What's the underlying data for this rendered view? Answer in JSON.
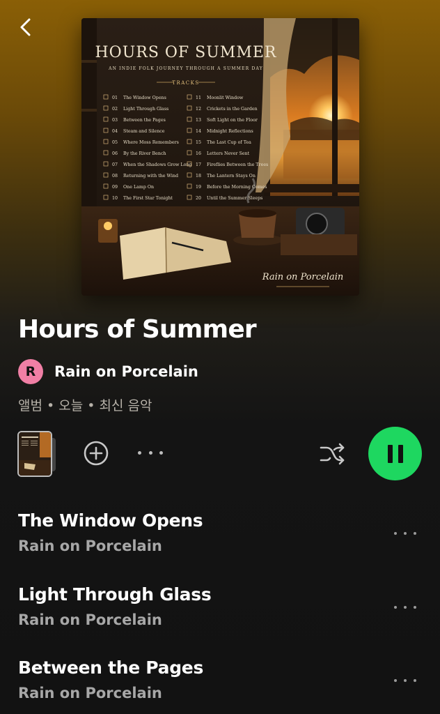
{
  "header": {
    "back_icon": "chevron-left-icon"
  },
  "cover": {
    "title": "HOURS OF SUMMER",
    "subtitle": "AN INDIE FOLK JOURNEY THROUGH A SUMMER DAY",
    "tracks_heading": "TRACKS",
    "signature": "Rain on Porcelain",
    "left_column": [
      {
        "num": "01",
        "title": "The Window Opens"
      },
      {
        "num": "02",
        "title": "Light Through Glass"
      },
      {
        "num": "03",
        "title": "Between the Pages"
      },
      {
        "num": "04",
        "title": "Steam and Silence"
      },
      {
        "num": "05",
        "title": "Where Moss Remembers"
      },
      {
        "num": "06",
        "title": "By the River Bench"
      },
      {
        "num": "07",
        "title": "When the Shadows Grow Long"
      },
      {
        "num": "08",
        "title": "Returning with the Wind"
      },
      {
        "num": "09",
        "title": "One Lamp On"
      },
      {
        "num": "10",
        "title": "The First Star Tonight"
      }
    ],
    "right_column": [
      {
        "num": "11",
        "title": "Moonlit Window"
      },
      {
        "num": "12",
        "title": "Crickets in the Garden"
      },
      {
        "num": "13",
        "title": "Soft Light on the Floor"
      },
      {
        "num": "14",
        "title": "Midnight Reflections"
      },
      {
        "num": "15",
        "title": "The Last Cup of Tea"
      },
      {
        "num": "16",
        "title": "Letters Never Sent"
      },
      {
        "num": "17",
        "title": "Fireflies Between the Trees"
      },
      {
        "num": "18",
        "title": "The Lantern Stays On"
      },
      {
        "num": "19",
        "title": "Before the Morning Comes"
      },
      {
        "num": "20",
        "title": "Until the Summer Sleeps"
      }
    ]
  },
  "album": {
    "title": "Hours of Summer",
    "artist_initial": "R",
    "artist": "Rain on Porcelain",
    "meta": "앨범 • 오늘 • 최신 음악"
  },
  "controls": {
    "add_icon": "plus-circle-icon",
    "more_icon": "more-horizontal-icon",
    "shuffle_icon": "shuffle-icon",
    "pause_icon": "pause-icon",
    "play_color": "#1ed760"
  },
  "tracks": [
    {
      "title": "The Window Opens",
      "artist": "Rain on Porcelain"
    },
    {
      "title": "Light Through Glass",
      "artist": "Rain on Porcelain"
    },
    {
      "title": "Between the Pages",
      "artist": "Rain on Porcelain"
    }
  ],
  "colors": {
    "background_top": "#8a5f06",
    "background_bottom": "#121212",
    "accent": "#1ed760"
  }
}
